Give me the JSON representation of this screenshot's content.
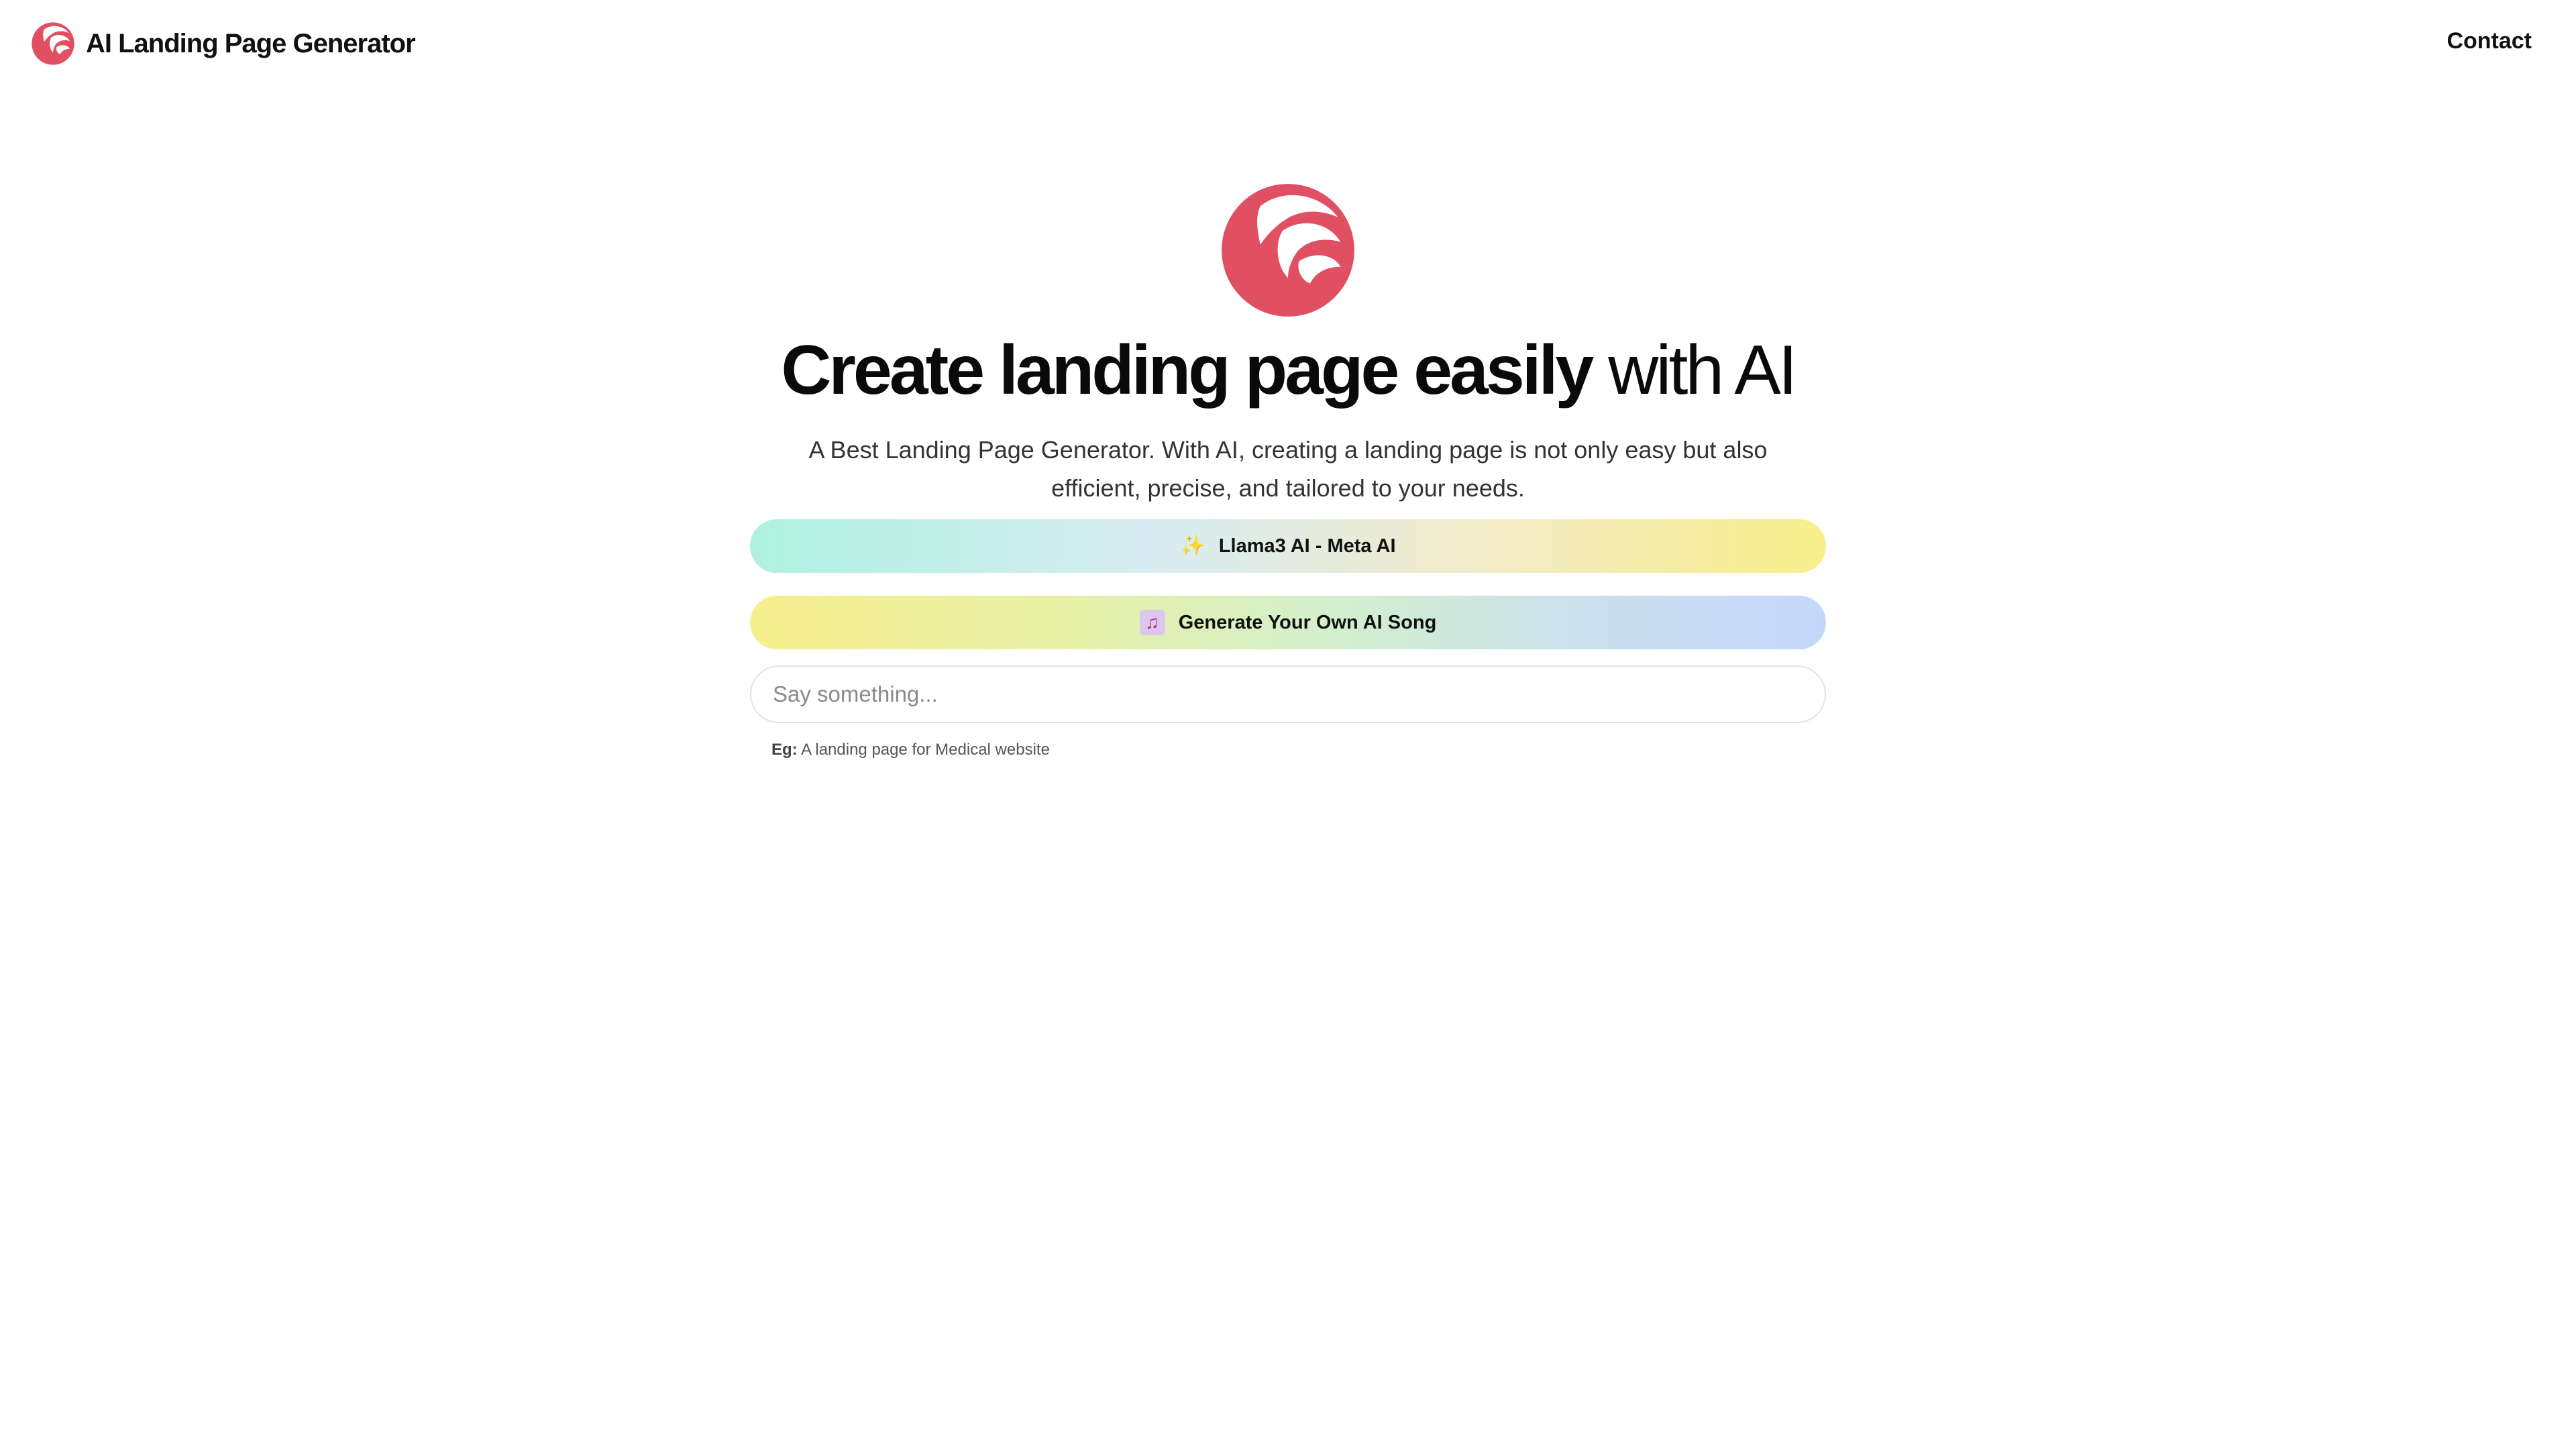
{
  "header": {
    "brand_title": "AI Landing Page Generator",
    "contact_label": "Contact"
  },
  "hero": {
    "headline_bold": "Create landing page easily",
    "headline_light": "with AI",
    "subtitle": "A Best Landing Page Generator. With AI, creating a landing page is not only easy but also efficient, precise, and tailored to your needs."
  },
  "actions": {
    "llama_label": "Llama3 AI - Meta AI",
    "llama_icon": "sparkles-icon",
    "song_label": "Generate Your Own AI Song",
    "song_icon": "music-note-icon"
  },
  "prompt": {
    "placeholder": "Say something...",
    "value": "",
    "example_label": "Eg:",
    "example_text": "A landing page for Medical website"
  },
  "colors": {
    "brand_red": "#e14f62",
    "text_dark": "#111111"
  }
}
